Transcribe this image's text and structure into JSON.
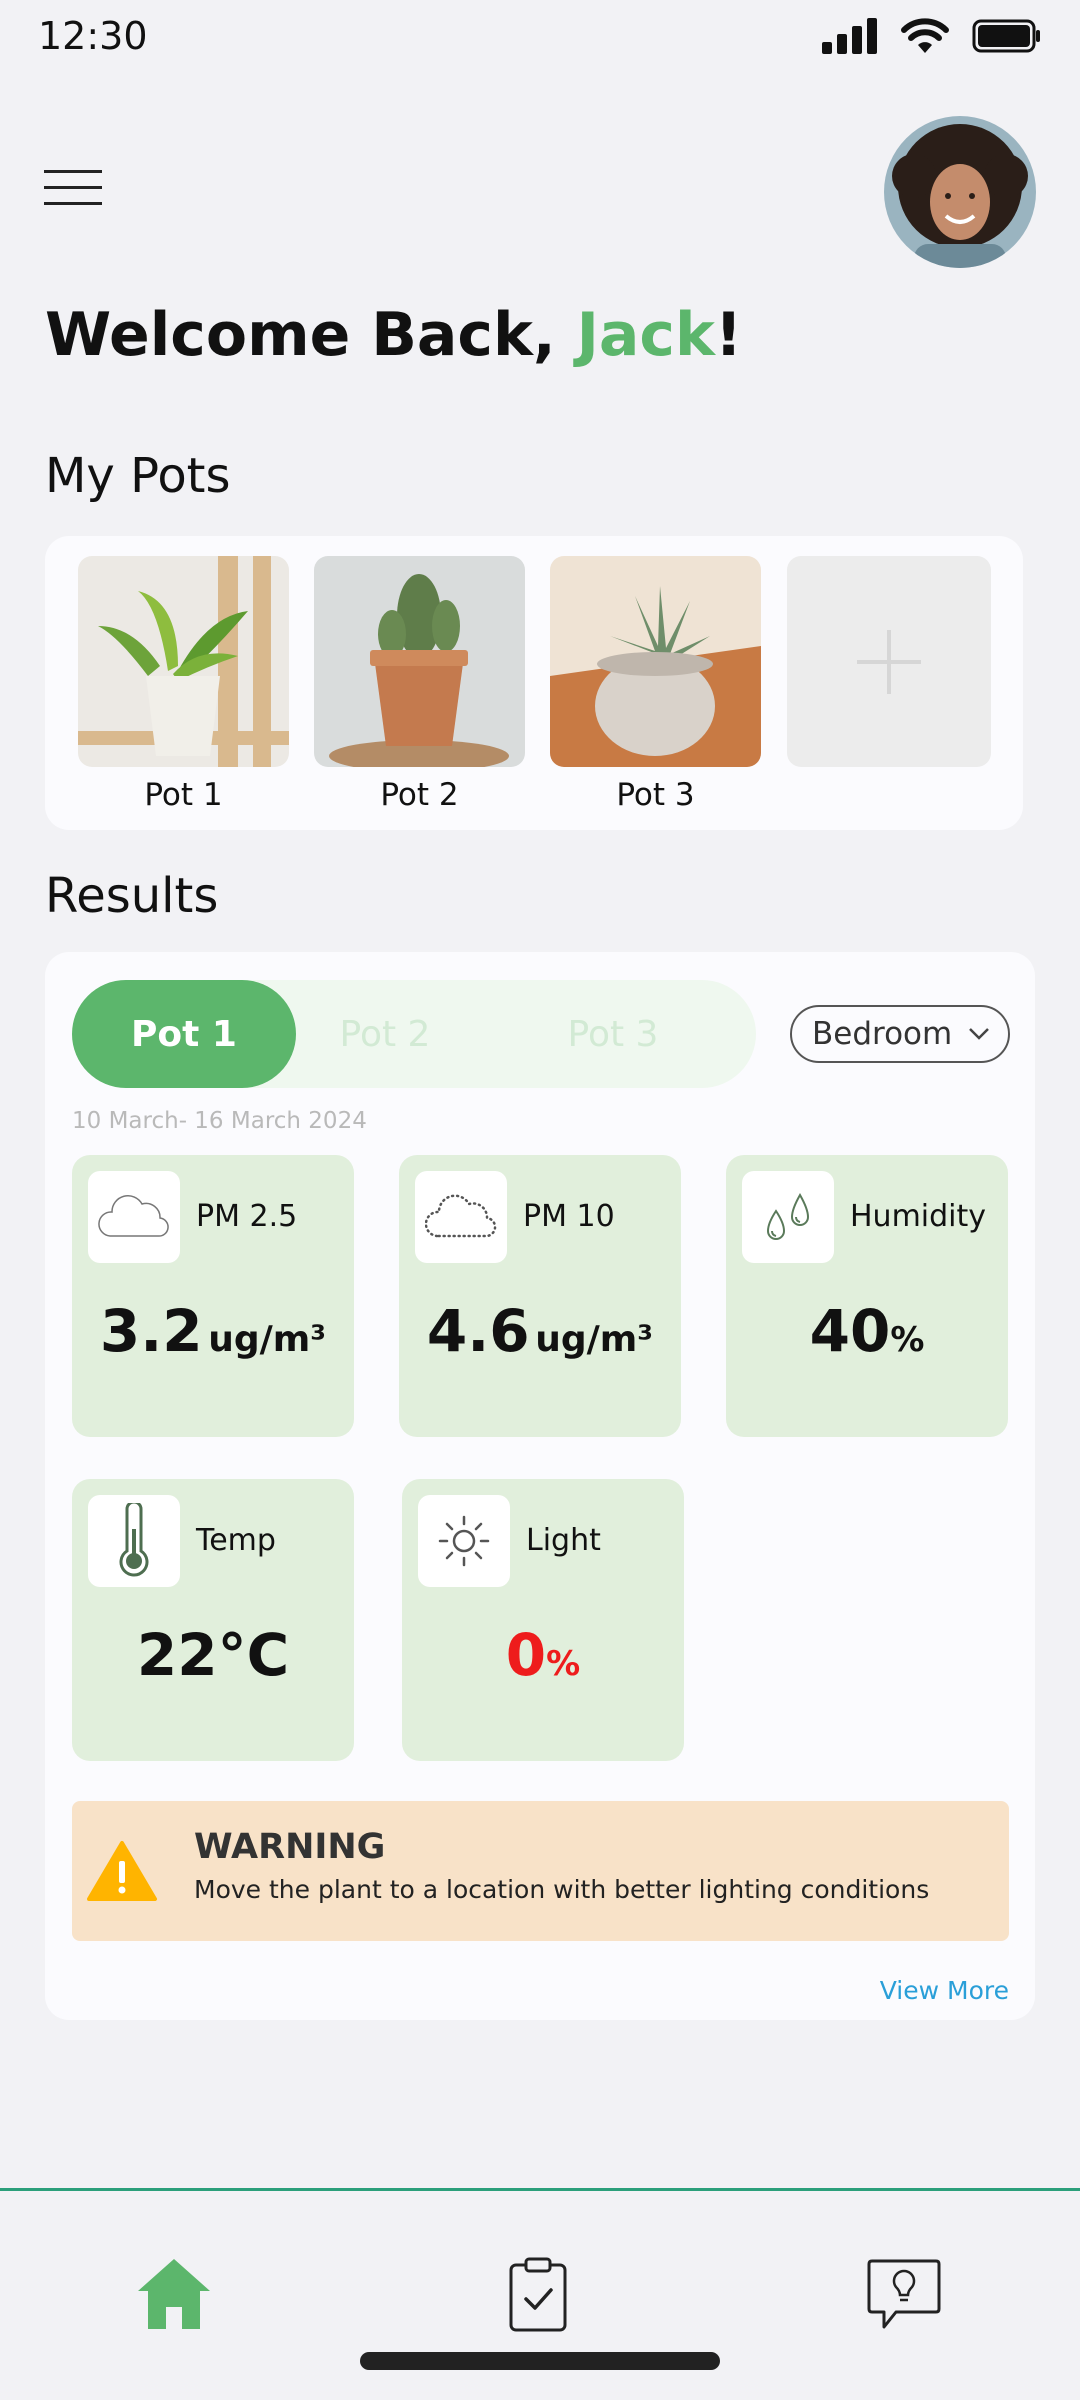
{
  "status_bar": {
    "time": "12:30"
  },
  "header": {
    "welcome_prefix": "Welcome Back, ",
    "user_name": "Jack",
    "welcome_suffix": "!"
  },
  "my_pots": {
    "title": "My Pots",
    "items": [
      {
        "label": "Pot 1"
      },
      {
        "label": "Pot 2"
      },
      {
        "label": "Pot 3"
      }
    ]
  },
  "results": {
    "title": "Results",
    "tabs": [
      {
        "label": "Pot 1",
        "active": true
      },
      {
        "label": "Pot 2",
        "active": false
      },
      {
        "label": "Pot 3",
        "active": false
      }
    ],
    "room_select": {
      "value": "Bedroom"
    },
    "date_range": "10 March- 16 March 2024",
    "metrics": [
      {
        "label": "PM 2.5",
        "value": "3.2",
        "unit": "ug/m³",
        "icon": "cloud-icon"
      },
      {
        "label": "PM 10",
        "value": "4.6",
        "unit": "ug/m³",
        "icon": "dotted-cloud-icon"
      },
      {
        "label": "Humidity",
        "value": "40",
        "unit": "%",
        "icon": "droplets-icon"
      },
      {
        "label": "Temp",
        "value": "22°C",
        "unit": "",
        "icon": "thermometer-icon"
      },
      {
        "label": "Light",
        "value": "0",
        "unit": "%",
        "icon": "sun-icon",
        "value_color": "#ee1c1c"
      }
    ],
    "warning": {
      "title": "WARNING",
      "message": "Move the plant to a location with better lighting conditions"
    },
    "view_more": "View More"
  },
  "colors": {
    "accent": "#5cb66c",
    "card_green": "#e1efdc",
    "warning_bg": "#f8e2c8",
    "warning_icon": "#ffb400",
    "link": "#2a9fd8",
    "nav_divider": "#2b9f7a"
  },
  "bottom_nav": [
    {
      "icon": "home-icon",
      "active": true
    },
    {
      "icon": "clipboard-check-icon",
      "active": false
    },
    {
      "icon": "lightbulb-chat-icon",
      "active": false
    }
  ]
}
